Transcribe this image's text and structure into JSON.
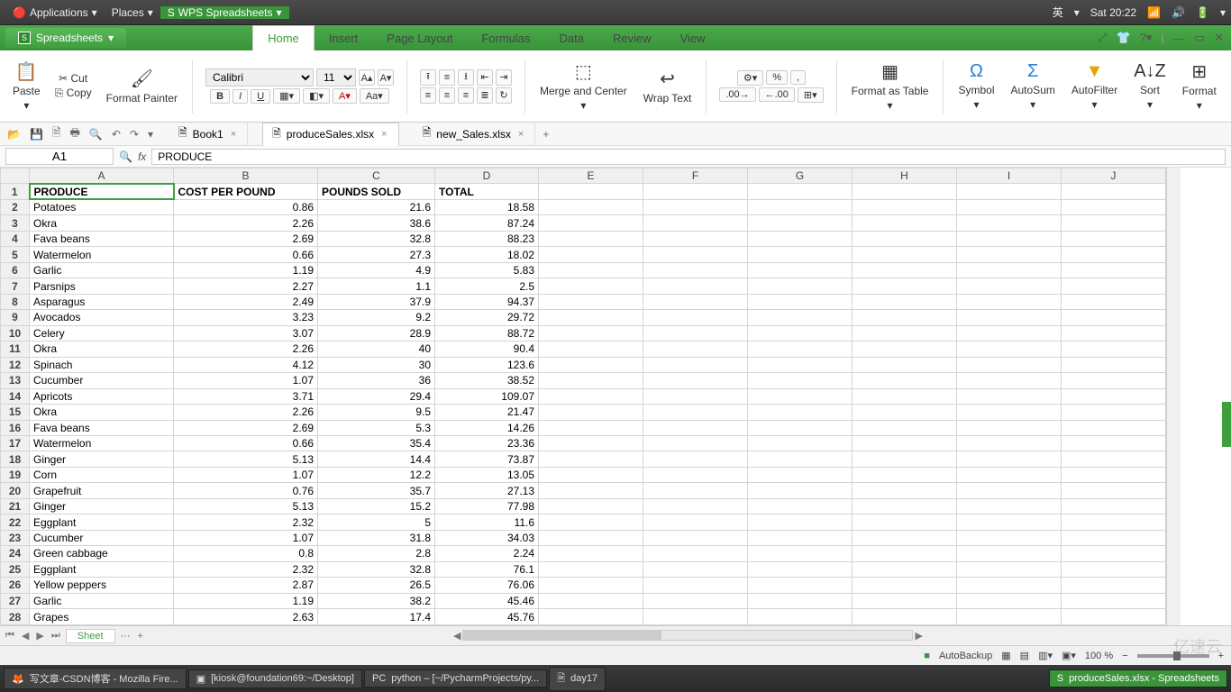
{
  "gnome": {
    "applications": "Applications",
    "places": "Places",
    "wps": "WPS Spreadsheets",
    "ime": "英",
    "clock": "Sat 20:22"
  },
  "app": {
    "title": "Spreadsheets",
    "ribbon_tabs": [
      "Home",
      "Insert",
      "Page Layout",
      "Formulas",
      "Data",
      "Review",
      "View"
    ],
    "active_tab": "Home"
  },
  "win_icons": [
    "⤢",
    "👕",
    "?",
    "|",
    "—",
    "▭",
    "✕"
  ],
  "ribbon": {
    "paste": "Paste",
    "cut": "Cut",
    "copy": "Copy",
    "format_painter": "Format Painter",
    "font_name": "Calibri",
    "font_size": "11",
    "bold": "B",
    "italic": "I",
    "underline": "U",
    "merge": "Merge and Center",
    "wrap": "Wrap Text",
    "format_table": "Format as Table",
    "symbol": "Symbol",
    "autosum": "AutoSum",
    "autofilter": "AutoFilter",
    "sort": "Sort",
    "format": "Format"
  },
  "docs": {
    "book1": "Book1",
    "produce": "produceSales.xlsx",
    "newsales": "new_Sales.xlsx"
  },
  "cell": {
    "ref": "A1",
    "formula": "PRODUCE"
  },
  "columns": [
    "A",
    "B",
    "C",
    "D",
    "E",
    "F",
    "G",
    "H",
    "I",
    "J"
  ],
  "headers": [
    "PRODUCE",
    "COST PER POUND",
    "POUNDS SOLD",
    "TOTAL"
  ],
  "rows": [
    [
      "Potatoes",
      "0.86",
      "21.6",
      "18.58"
    ],
    [
      "Okra",
      "2.26",
      "38.6",
      "87.24"
    ],
    [
      "Fava beans",
      "2.69",
      "32.8",
      "88.23"
    ],
    [
      "Watermelon",
      "0.66",
      "27.3",
      "18.02"
    ],
    [
      "Garlic",
      "1.19",
      "4.9",
      "5.83"
    ],
    [
      "Parsnips",
      "2.27",
      "1.1",
      "2.5"
    ],
    [
      "Asparagus",
      "2.49",
      "37.9",
      "94.37"
    ],
    [
      "Avocados",
      "3.23",
      "9.2",
      "29.72"
    ],
    [
      "Celery",
      "3.07",
      "28.9",
      "88.72"
    ],
    [
      "Okra",
      "2.26",
      "40",
      "90.4"
    ],
    [
      "Spinach",
      "4.12",
      "30",
      "123.6"
    ],
    [
      "Cucumber",
      "1.07",
      "36",
      "38.52"
    ],
    [
      "Apricots",
      "3.71",
      "29.4",
      "109.07"
    ],
    [
      "Okra",
      "2.26",
      "9.5",
      "21.47"
    ],
    [
      "Fava beans",
      "2.69",
      "5.3",
      "14.26"
    ],
    [
      "Watermelon",
      "0.66",
      "35.4",
      "23.36"
    ],
    [
      "Ginger",
      "5.13",
      "14.4",
      "73.87"
    ],
    [
      "Corn",
      "1.07",
      "12.2",
      "13.05"
    ],
    [
      "Grapefruit",
      "0.76",
      "35.7",
      "27.13"
    ],
    [
      "Ginger",
      "5.13",
      "15.2",
      "77.98"
    ],
    [
      "Eggplant",
      "2.32",
      "5",
      "11.6"
    ],
    [
      "Cucumber",
      "1.07",
      "31.8",
      "34.03"
    ],
    [
      "Green cabbage",
      "0.8",
      "2.8",
      "2.24"
    ],
    [
      "Eggplant",
      "2.32",
      "32.8",
      "76.1"
    ],
    [
      "Yellow peppers",
      "2.87",
      "26.5",
      "76.06"
    ],
    [
      "Garlic",
      "1.19",
      "38.2",
      "45.46"
    ],
    [
      "Grapes",
      "2.63",
      "17.4",
      "45.76"
    ]
  ],
  "sheet": {
    "name": "Sheet"
  },
  "status": {
    "autobackup": "AutoBackup",
    "zoom": "100 %"
  },
  "taskbar": {
    "t1": "写文章-CSDN博客 - Mozilla Fire...",
    "t2": "[kiosk@foundation69:~/Desktop]",
    "t3": "python – [~/PycharmProjects/py...",
    "t4": "day17",
    "t5": "produceSales.xlsx - Spreadsheets"
  },
  "watermark": "亿速云"
}
